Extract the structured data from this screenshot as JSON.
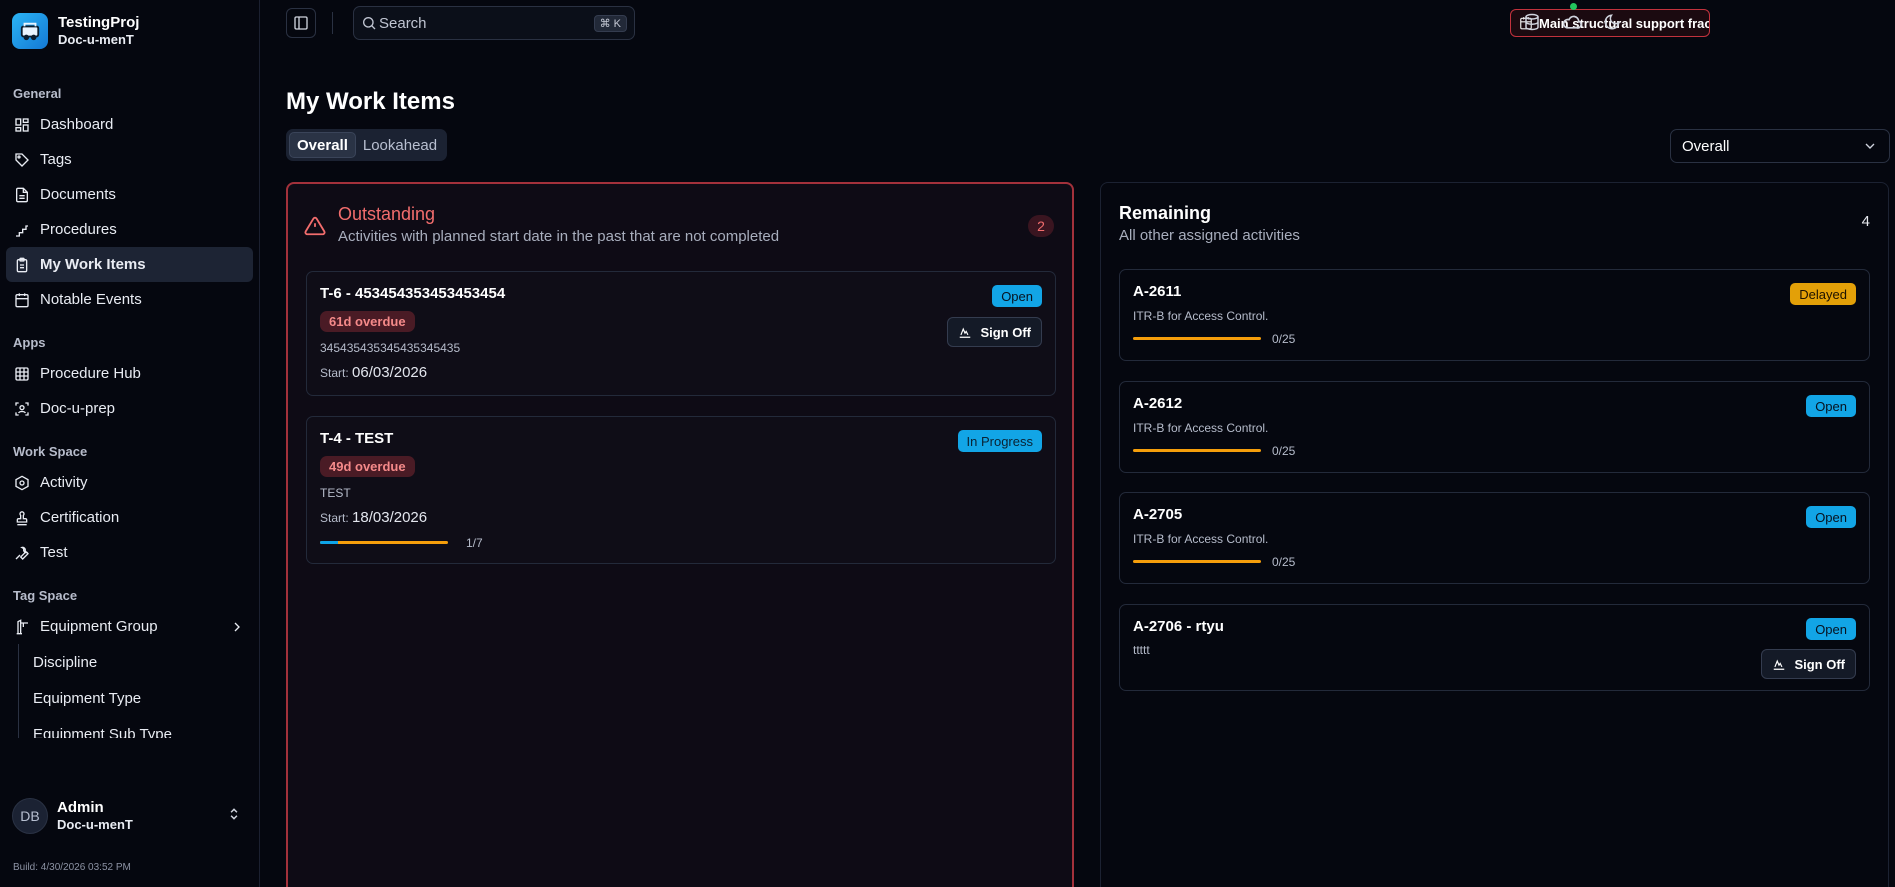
{
  "brand": {
    "name": "TestingProj",
    "org": "Doc-u-menT"
  },
  "sidebar": {
    "sections": [
      {
        "label": "General",
        "items": [
          {
            "label": "Dashboard",
            "icon": "dashboard-icon"
          },
          {
            "label": "Tags",
            "icon": "tag-icon"
          },
          {
            "label": "Documents",
            "icon": "document-icon"
          },
          {
            "label": "Procedures",
            "icon": "stairs-icon"
          },
          {
            "label": "My Work Items",
            "icon": "clipboard-icon",
            "active": true
          },
          {
            "label": "Notable Events",
            "icon": "calendar-icon"
          }
        ]
      },
      {
        "label": "Apps",
        "items": [
          {
            "label": "Procedure Hub",
            "icon": "grid-icon"
          },
          {
            "label": "Doc-u-prep",
            "icon": "scan-icon"
          }
        ]
      },
      {
        "label": "Work Space",
        "items": [
          {
            "label": "Activity",
            "icon": "hexagon-icon"
          },
          {
            "label": "Certification",
            "icon": "stamp-icon"
          },
          {
            "label": "Test",
            "icon": "wrench-icon"
          }
        ]
      },
      {
        "label": "Tag Space",
        "items": [
          {
            "label": "Equipment Group",
            "icon": "crane-icon",
            "expandable": true
          }
        ]
      }
    ],
    "sub_items": [
      "Discipline",
      "Equipment Type",
      "Equipment Sub Type"
    ],
    "user": {
      "initials": "DB",
      "name": "Admin",
      "org": "Doc-u-menT"
    },
    "build": "Build: 4/30/2026 03:52 PM"
  },
  "topbar": {
    "search_placeholder": "Search",
    "shortcut": "⌘ K",
    "alert": "Main structural support fractur..."
  },
  "page": {
    "title": "My Work Items",
    "tabs": [
      "Overall",
      "Lookahead"
    ],
    "active_tab": "Overall",
    "filter_value": "Overall"
  },
  "outstanding": {
    "title": "Outstanding",
    "subtitle": "Activities with planned start date in the past that are not completed",
    "count": "2",
    "cards": [
      {
        "title": "T-6 - 453454353453453454",
        "overdue": "61d overdue",
        "desc": "345435435345435345435",
        "start_label": "Start:",
        "start": "06/03/2026",
        "status": "Open",
        "signoff": "Sign Off"
      },
      {
        "title": "T-4 - TEST",
        "overdue": "49d overdue",
        "desc": "TEST",
        "start_label": "Start:",
        "start": "18/03/2026",
        "status": "In Progress",
        "progress": "1/7",
        "progress_fraction": 0.143
      }
    ]
  },
  "remaining": {
    "title": "Remaining",
    "subtitle": "All other assigned activities",
    "count": "4",
    "cards": [
      {
        "title": "A-2611",
        "desc": "ITR-B for Access Control.",
        "status": "Delayed",
        "progress": "0/25"
      },
      {
        "title": "A-2612",
        "desc": "ITR-B for Access Control.",
        "status": "Open",
        "progress": "0/25"
      },
      {
        "title": "A-2705",
        "desc": "ITR-B for Access Control.",
        "status": "Open",
        "progress": "0/25"
      },
      {
        "title": "A-2706 - rtyu",
        "desc": "ttttt",
        "status": "Open",
        "signoff": "Sign Off"
      }
    ]
  },
  "colors": {
    "accent": "#12a5e6",
    "danger": "#f26d6d",
    "warning": "#e3a008",
    "progress": "#f59e0b"
  }
}
